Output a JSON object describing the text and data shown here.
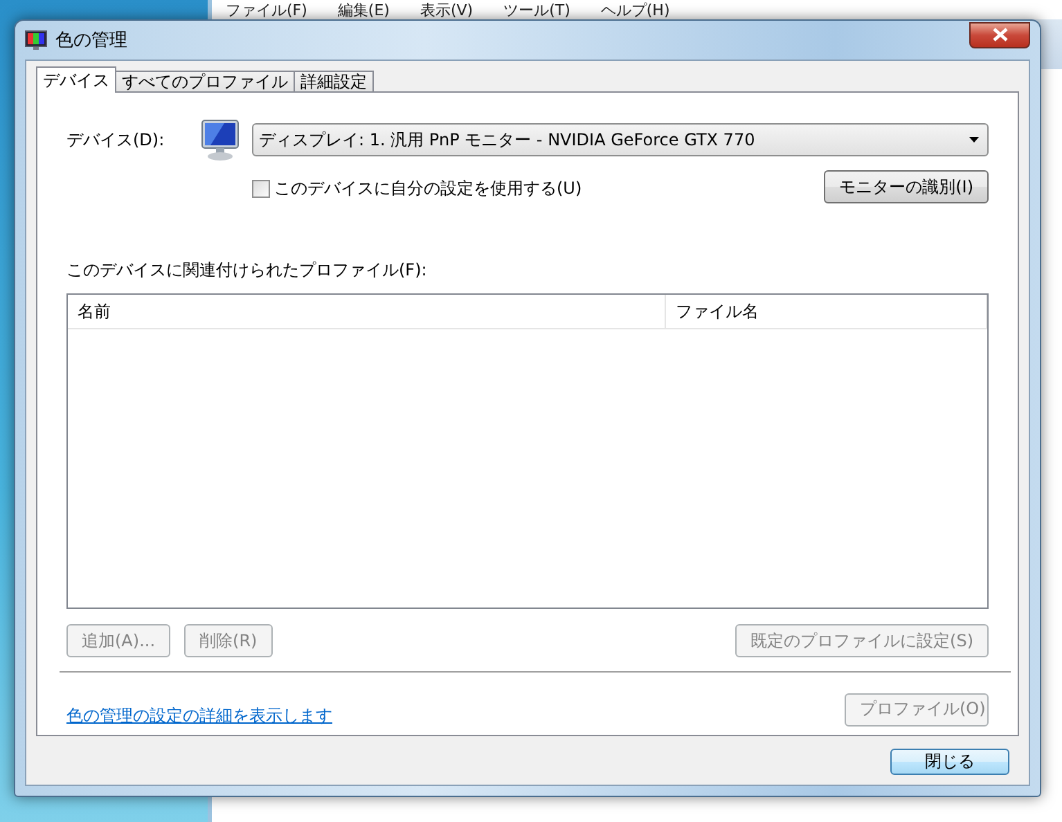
{
  "background_window": {
    "menu": [
      "ファイル(F)",
      "編集(E)",
      "表示(V)",
      "ツール(T)",
      "ヘルプ(H)"
    ]
  },
  "window": {
    "title": "色の管理"
  },
  "tabs": [
    {
      "label": "デバイス",
      "selected": true
    },
    {
      "label": "すべてのプロファイル",
      "selected": false
    },
    {
      "label": "詳細設定",
      "selected": false
    }
  ],
  "device": {
    "label": "デバイス(D):",
    "value": "ディスプレイ: 1. 汎用 PnP モニター - NVIDIA GeForce GTX 770"
  },
  "use_my_settings": {
    "label": "このデバイスに自分の設定を使用する(U)",
    "checked": false
  },
  "identify_button": {
    "label": "モニターの識別(I)",
    "disabled": false
  },
  "profiles_label": "このデバイスに関連付けられたプロファイル(F):",
  "table": {
    "columns": [
      "名前",
      "ファイル名"
    ]
  },
  "profile_buttons": [
    {
      "label": "追加(A)...",
      "disabled": true
    },
    {
      "label": "削除(R)",
      "disabled": true
    },
    {
      "label": "既定のプロファイルに設定(S)",
      "disabled": true
    }
  ],
  "link": "色の管理の設定の詳細を表示します",
  "profile_button": {
    "label": "プロファイル(O)",
    "disabled": true
  },
  "close_button": {
    "label": "閉じる",
    "disabled": false
  }
}
